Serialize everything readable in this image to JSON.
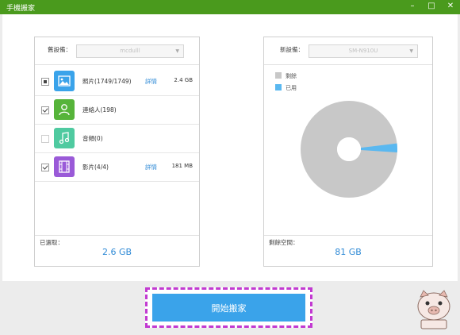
{
  "window": {
    "title": "手機搬家",
    "min_icon": "minimize-icon",
    "max_icon": "maximize-icon",
    "close_icon": "close-icon"
  },
  "left": {
    "device_label": "舊設備：",
    "device_value": "mcdulll",
    "items": [
      {
        "label": "照片(1749/1749)",
        "detail": "詳情",
        "size": "2.4 GB",
        "icon": "photo-icon",
        "color": "#3aa3ea",
        "state": "partial"
      },
      {
        "label": "連絡人(198)",
        "detail": "",
        "size": "",
        "icon": "contact-icon",
        "color": "#56b43a",
        "state": "checked"
      },
      {
        "label": "音頻(0)",
        "detail": "",
        "size": "",
        "icon": "music-icon",
        "color": "#4fcaa0",
        "state": "disabled"
      },
      {
        "label": "影片(4/4)",
        "detail": "詳情",
        "size": "181 MB",
        "icon": "video-icon",
        "color": "#9a5ad8",
        "state": "checked"
      }
    ],
    "selected_label": "已選取：",
    "selected_value": "2.6 GB"
  },
  "right": {
    "device_label": "新設備：",
    "device_value": "SM-N910U",
    "legend": [
      {
        "label": "剩餘",
        "color": "#c8c8c8"
      },
      {
        "label": "已用",
        "color": "#5ab8f0"
      }
    ],
    "chart_used_percent": 3,
    "remaining_label": "剩餘空間：",
    "remaining_value": "81 GB"
  },
  "start_button": "開始搬家"
}
